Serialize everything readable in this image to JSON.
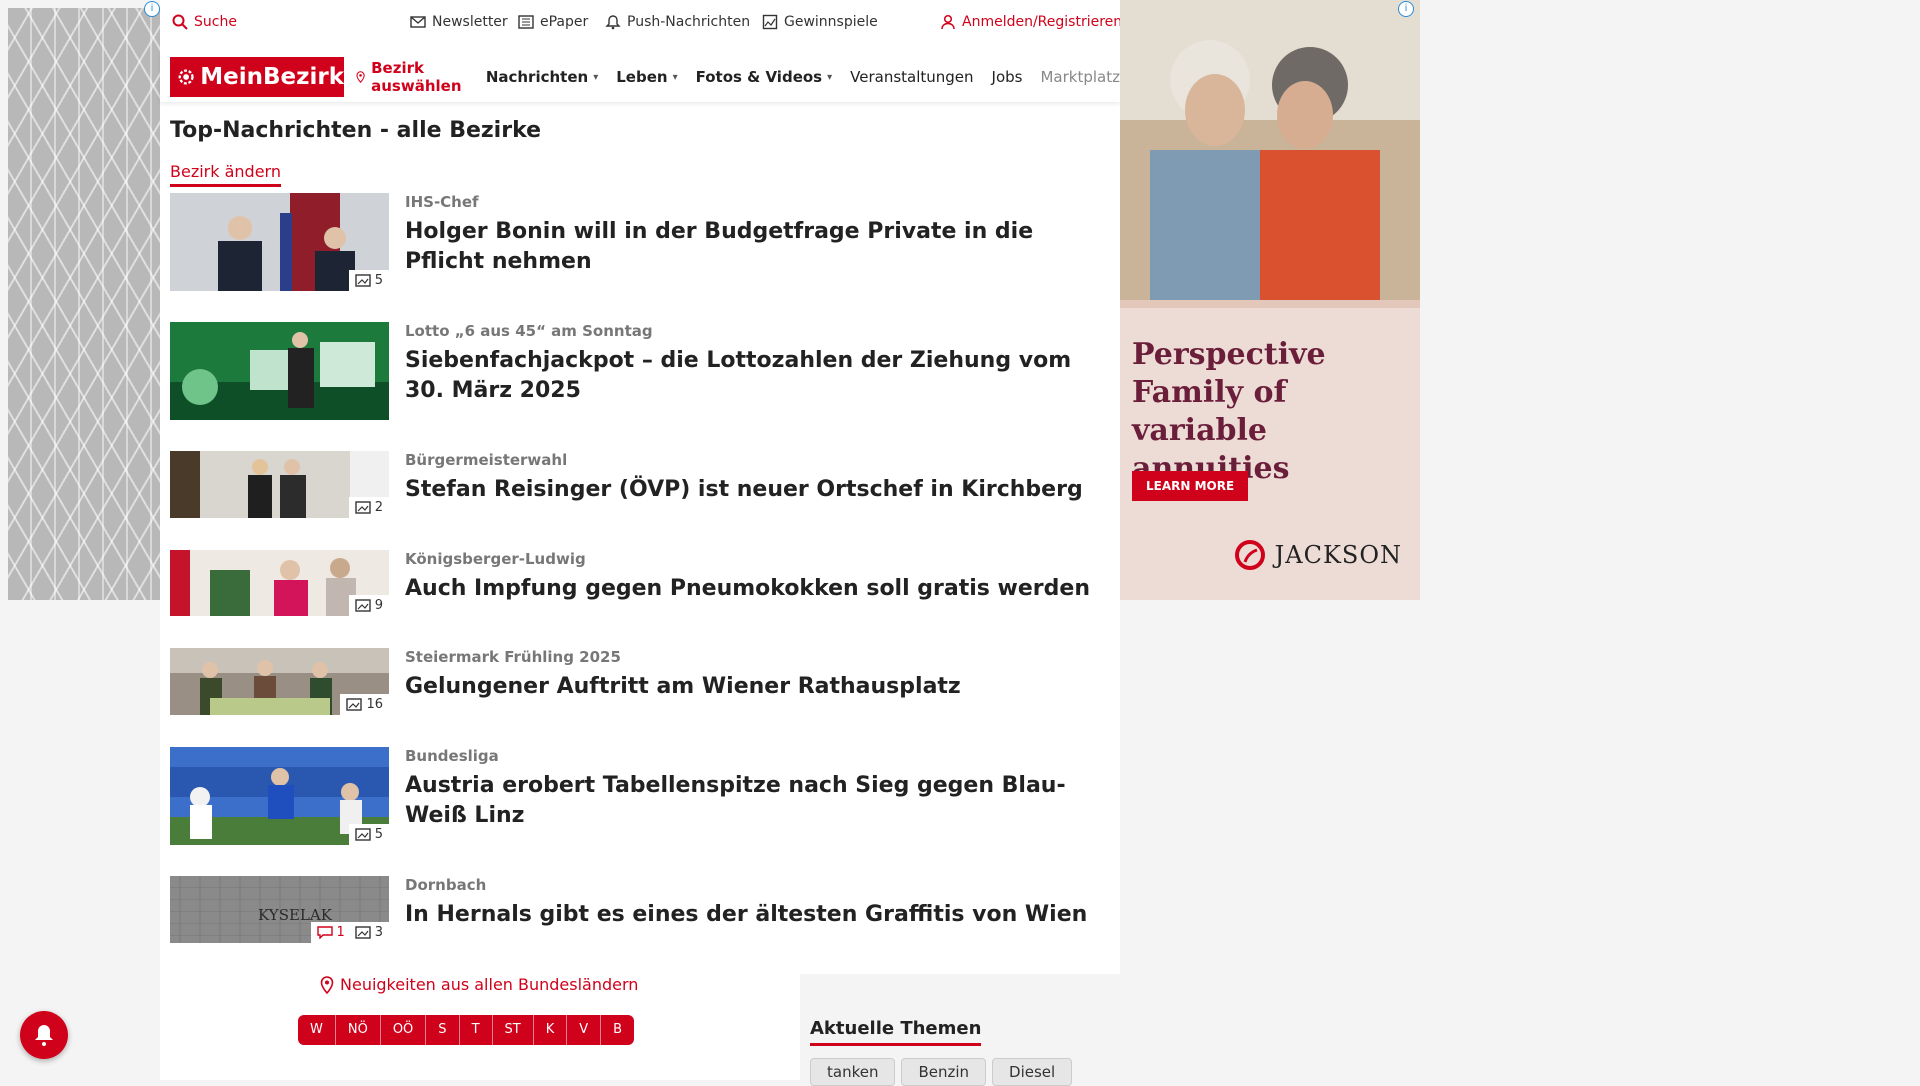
{
  "utility": {
    "search": "Suche",
    "newsletter": "Newsletter",
    "epaper": "ePaper",
    "push": "Push-Nachrichten",
    "games": "Gewinnspiele",
    "login": "Anmelden/Registrieren"
  },
  "nav": {
    "logo": "MeinBezirk",
    "bezirk": "Bezirk auswählen",
    "items": [
      "Nachrichten",
      "Leben",
      "Fotos & Videos",
      "Veranstaltungen",
      "Jobs",
      "Marktplatz"
    ]
  },
  "page": {
    "title": "Top-Nachrichten - alle Bezirke",
    "change_link": "Bezirk ändern"
  },
  "articles": [
    {
      "kicker": "IHS-Chef",
      "headline": "Holger Bonin will in der Budgetfrage Private in die Pflicht nehmen",
      "photos": "5"
    },
    {
      "kicker": "Lotto „6 aus 45“ am Sonntag",
      "headline": "Siebenfachjackpot – die Lottozahlen der Ziehung vom 30. März 2025",
      "photos": ""
    },
    {
      "kicker": "Bürgermeisterwahl",
      "headline": "Stefan Reisinger (ÖVP) ist neuer Ortschef in Kirchberg",
      "photos": "2"
    },
    {
      "kicker": "Königsberger-Ludwig",
      "headline": "Auch Impfung gegen Pneumokokken soll gratis werden",
      "photos": "9"
    },
    {
      "kicker": "Steiermark Frühling 2025",
      "headline": "Gelungener Auftritt am Wiener Rathausplatz",
      "photos": "16"
    },
    {
      "kicker": "Bundesliga",
      "headline": "Austria erobert Tabellenspitze nach Sieg gegen Blau-Weiß Linz",
      "photos": "5"
    },
    {
      "kicker": "Dornbach",
      "headline": "In Hernals gibt es eines der ältesten Graffitis von Wien",
      "photos": "3",
      "comments": "1"
    }
  ],
  "bundeslaender": {
    "link": "Neuigkeiten aus allen Bundesländern",
    "states": [
      "W",
      "NÖ",
      "OÖ",
      "S",
      "T",
      "ST",
      "K",
      "V",
      "B"
    ]
  },
  "themen": {
    "title": "Aktuelle Themen",
    "tags": [
      "tanken",
      "Benzin",
      "Diesel"
    ]
  },
  "ad": {
    "headline": "Perspective Family of variable annuities",
    "cta": "LEARN MORE",
    "brand": "JACKSON"
  },
  "colors": {
    "accent": "#d0021b",
    "ad_text": "#6b1e3a",
    "ad_bg": "#ecdcd5"
  }
}
